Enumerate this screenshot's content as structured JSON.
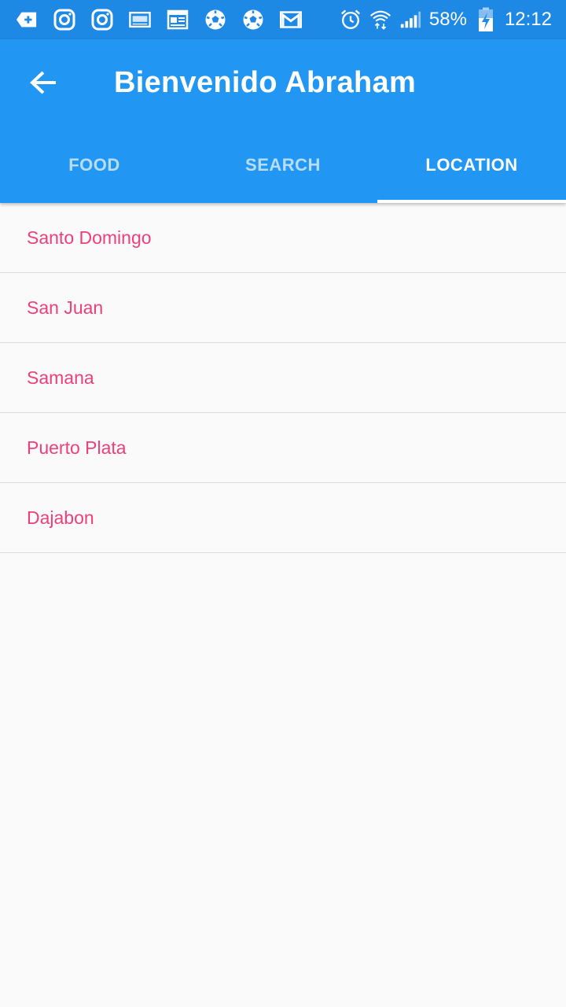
{
  "status_bar": {
    "notification_icons": [
      "add-app-icon",
      "instagram-icon",
      "instagram-icon",
      "screenshot-icon",
      "news-icon",
      "soccer-ball-icon",
      "soccer-ball-icon",
      "gmail-icon"
    ],
    "battery_percent": "58%",
    "time": "12:12"
  },
  "app_bar": {
    "title": "Bienvenido Abraham",
    "background_color": "#2196f3"
  },
  "tabs": [
    {
      "label": "FOOD",
      "active": false
    },
    {
      "label": "SEARCH",
      "active": false
    },
    {
      "label": "LOCATION",
      "active": true
    }
  ],
  "locations": [
    {
      "label": "Santo Domingo"
    },
    {
      "label": "San Juan"
    },
    {
      "label": "Samana"
    },
    {
      "label": "Puerto Plata"
    },
    {
      "label": "Dajabon"
    }
  ],
  "colors": {
    "accent": "#ec407a",
    "primary": "#2196f3",
    "status_bar": "#1e88e5"
  }
}
